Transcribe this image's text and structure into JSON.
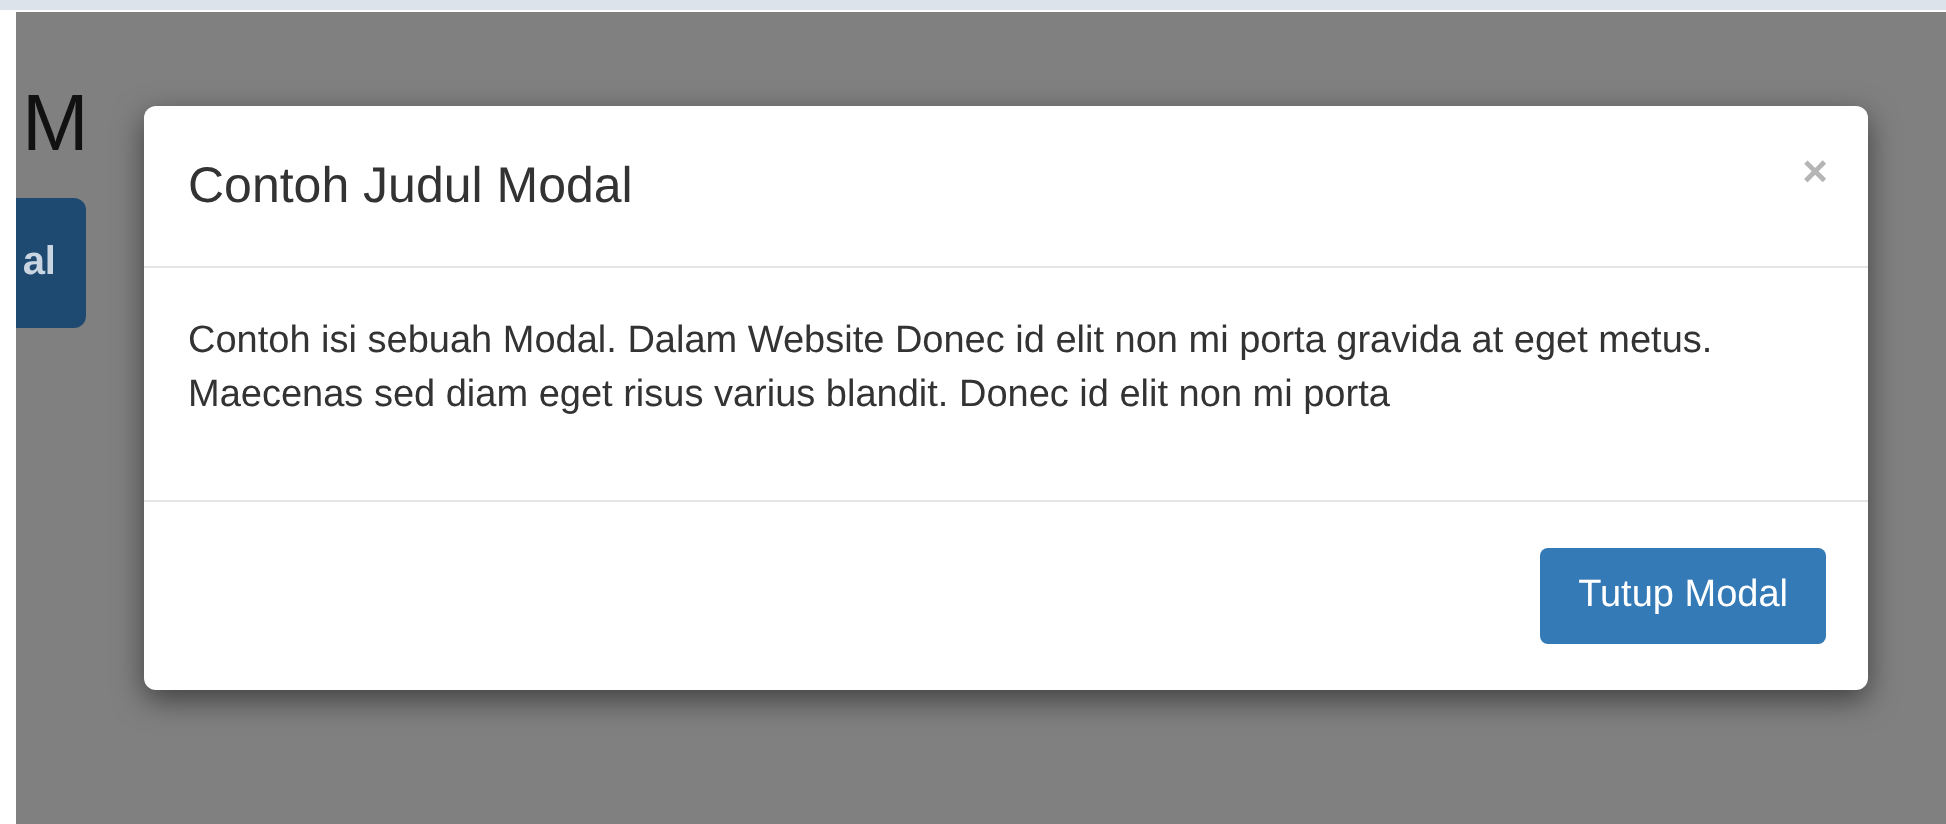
{
  "page": {
    "heading": "M",
    "button": "al"
  },
  "modal": {
    "title": "Contoh Judul Modal",
    "close": "×",
    "body": "Contoh isi sebuah Modal. Dalam Website Donec id elit non mi porta gravida at eget metus. Maecenas sed diam eget risus varius blandit. Donec id elit non mi porta",
    "buttons": [
      "Tutup Modal"
    ]
  }
}
